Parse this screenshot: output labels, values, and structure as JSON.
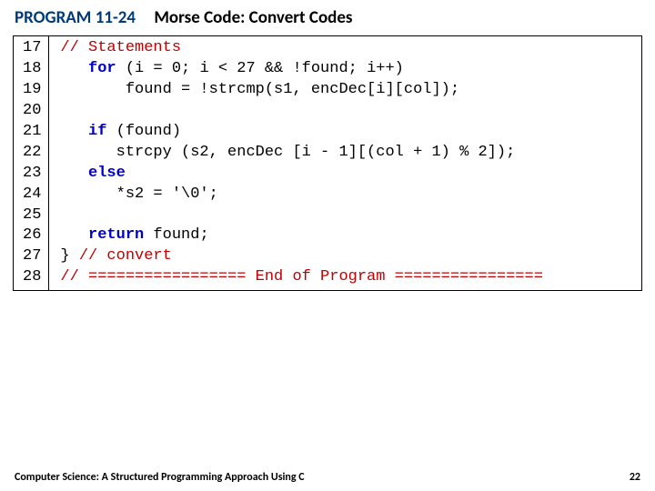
{
  "header": {
    "program_label": "PROGRAM 11-24",
    "title": "Morse Code: Convert Codes"
  },
  "code": {
    "line_start": 17,
    "line_end": 28,
    "lines": [
      {
        "tokens": [
          {
            "c": "comment",
            "t": "// Statements"
          }
        ]
      },
      {
        "tokens": [
          {
            "c": "plain",
            "t": "   "
          },
          {
            "c": "kw",
            "t": "for"
          },
          {
            "c": "plain",
            "t": " (i = 0; i < 27 && !found; i++)"
          }
        ]
      },
      {
        "tokens": [
          {
            "c": "plain",
            "t": "       found = !strcmp(s1, encDec[i][col]);"
          }
        ]
      },
      {
        "tokens": []
      },
      {
        "tokens": [
          {
            "c": "plain",
            "t": "   "
          },
          {
            "c": "kw",
            "t": "if"
          },
          {
            "c": "plain",
            "t": " (found)"
          }
        ]
      },
      {
        "tokens": [
          {
            "c": "plain",
            "t": "      strcpy (s2, encDec [i - 1][(col + 1) % 2]);"
          }
        ]
      },
      {
        "tokens": [
          {
            "c": "plain",
            "t": "   "
          },
          {
            "c": "kw",
            "t": "else"
          }
        ]
      },
      {
        "tokens": [
          {
            "c": "plain",
            "t": "      *s2 = '\\0';"
          }
        ]
      },
      {
        "tokens": []
      },
      {
        "tokens": [
          {
            "c": "plain",
            "t": "   "
          },
          {
            "c": "kw",
            "t": "return"
          },
          {
            "c": "plain",
            "t": " found;"
          }
        ]
      },
      {
        "tokens": [
          {
            "c": "plain",
            "t": "} "
          },
          {
            "c": "comment",
            "t": "// convert"
          }
        ]
      },
      {
        "tokens": [
          {
            "c": "comment",
            "t": "// ================= End of Program ================"
          }
        ]
      }
    ]
  },
  "footer": {
    "book": "Computer Science: A Structured Programming Approach Using C",
    "page": "22"
  }
}
